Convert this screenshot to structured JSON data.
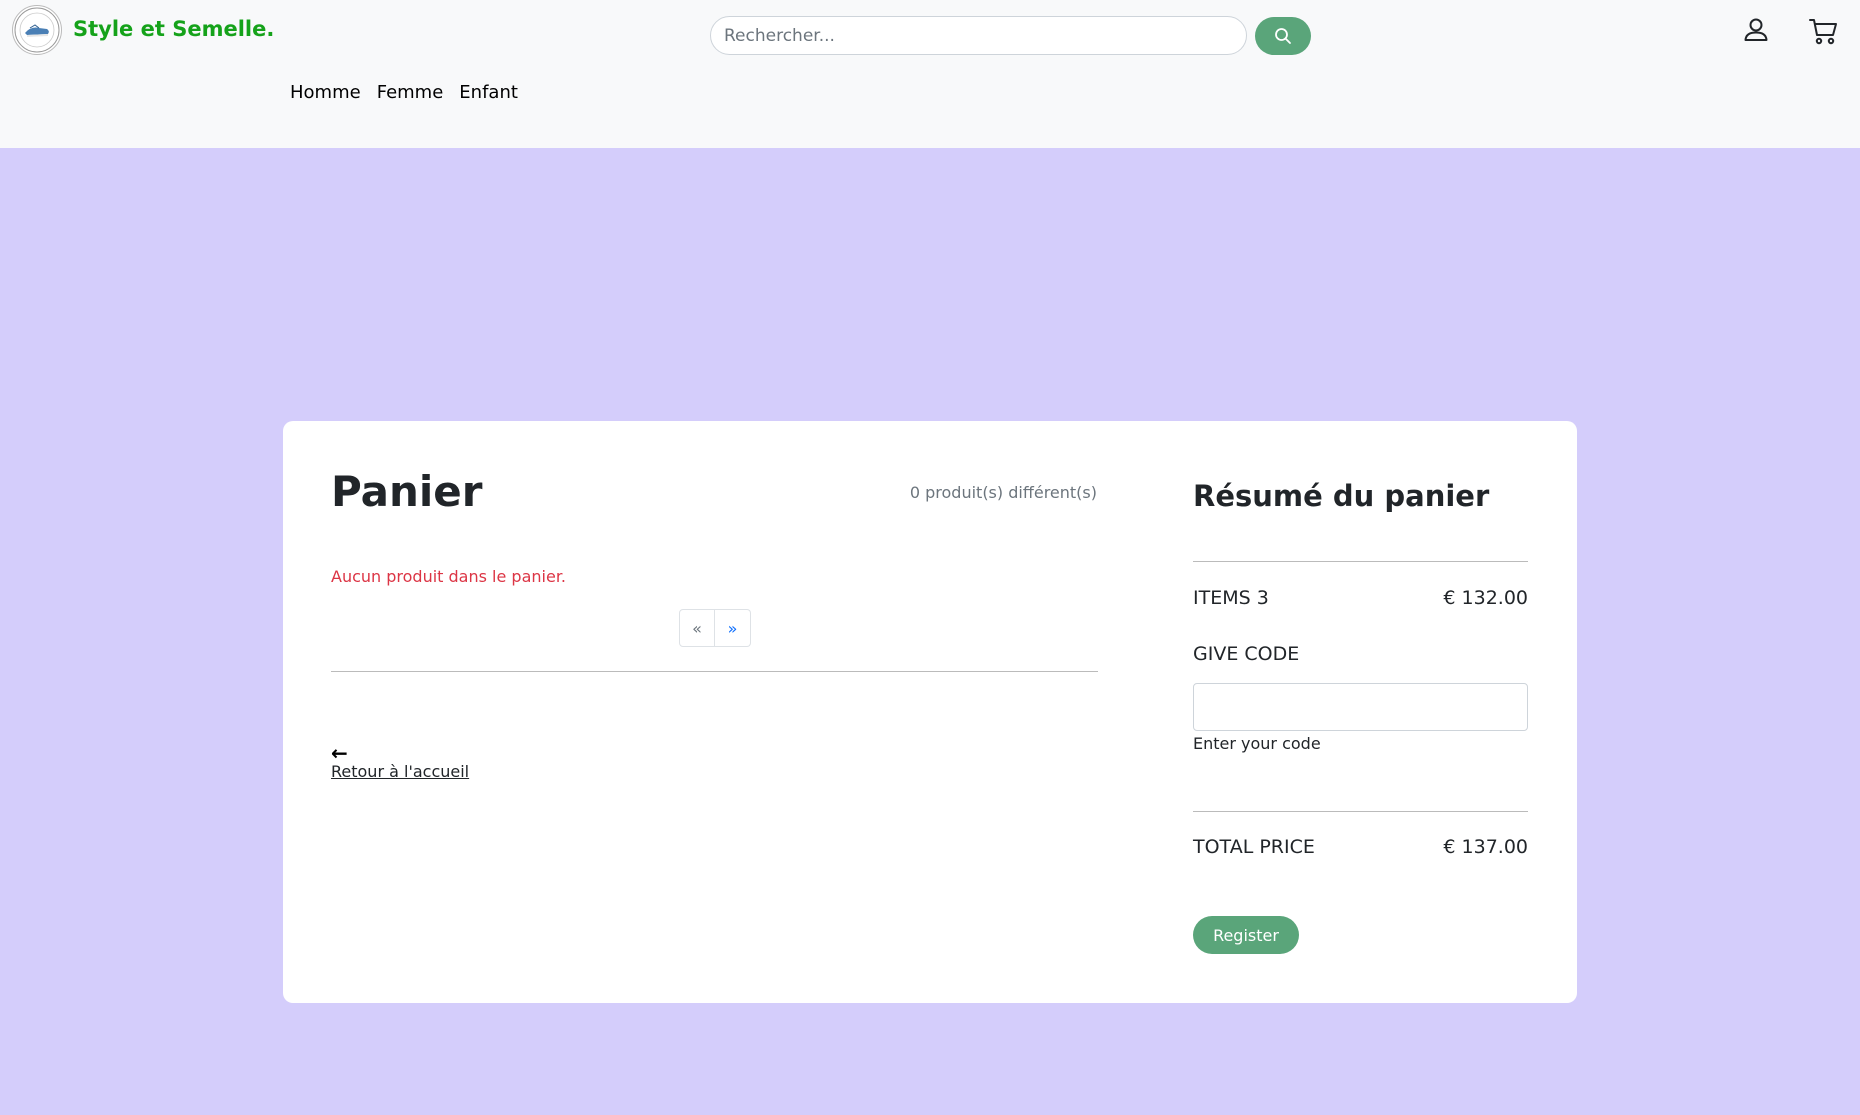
{
  "header": {
    "brand": "Style et Semelle.",
    "search_placeholder": "Rechercher...",
    "nav": [
      "Homme",
      "Femme",
      "Enfant"
    ],
    "icons": [
      "search-icon",
      "user-icon",
      "cart-icon"
    ]
  },
  "cart": {
    "title": "Panier",
    "product_count": "0 produit(s) différent(s)",
    "empty_message": "Aucun produit dans le panier.",
    "pagination": {
      "prev": "«",
      "next": "»"
    },
    "back_arrow": "←",
    "back_link": "Retour à l'accueil"
  },
  "summary": {
    "title": "Résumé du panier",
    "items_label": "ITEMS 3",
    "items_value": "€ 132.00",
    "code_label": "GIVE CODE",
    "code_help": "Enter your code",
    "total_label": "TOTAL PRICE",
    "total_value": "€ 137.00",
    "register_label": "Register"
  },
  "colors": {
    "background": "#d4cdfb",
    "brand": "#15a21a",
    "accent_button": "#5aa57a",
    "error": "#dc3545"
  }
}
